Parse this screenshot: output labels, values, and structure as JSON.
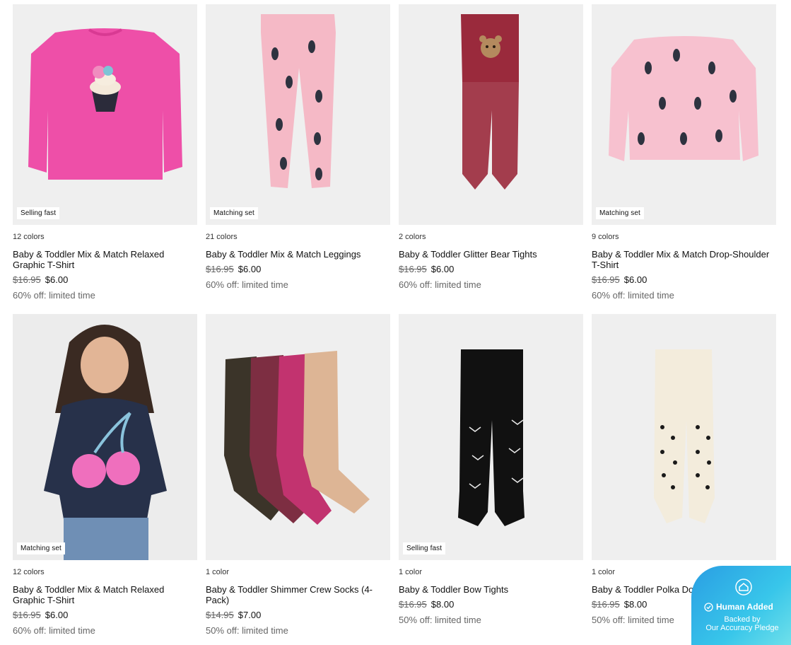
{
  "products": [
    {
      "colors": "12 colors",
      "name": "Baby & Toddler Mix & Match Relaxed Graphic T-Shirt",
      "old_price": "$16.95",
      "price": "$6.00",
      "promo": "60% off: limited time",
      "badge": "Selling fast"
    },
    {
      "colors": "21 colors",
      "name": "Baby & Toddler Mix & Match Leggings",
      "old_price": "$16.95",
      "price": "$6.00",
      "promo": "60% off: limited time",
      "badge": "Matching set"
    },
    {
      "colors": "2 colors",
      "name": "Baby & Toddler Glitter Bear Tights",
      "old_price": "$16.95",
      "price": "$6.00",
      "promo": "60% off: limited time",
      "badge": ""
    },
    {
      "colors": "9 colors",
      "name": "Baby & Toddler Mix & Match Drop-Shoulder T-Shirt",
      "old_price": "$16.95",
      "price": "$6.00",
      "promo": "60% off: limited time",
      "badge": "Matching set"
    },
    {
      "colors": "12 colors",
      "name": "Baby & Toddler Mix & Match Relaxed Graphic T-Shirt",
      "old_price": "$16.95",
      "price": "$6.00",
      "promo": "60% off: limited time",
      "badge": "Matching set"
    },
    {
      "colors": "1 color",
      "name": "Baby & Toddler Shimmer Crew Socks (4-Pack)",
      "old_price": "$14.95",
      "price": "$7.00",
      "promo": "50% off: limited time",
      "badge": ""
    },
    {
      "colors": "1 color",
      "name": "Baby & Toddler Bow Tights",
      "old_price": "$16.95",
      "price": "$8.00",
      "promo": "50% off: limited time",
      "badge": "Selling fast"
    },
    {
      "colors": "1 color",
      "name": "Baby & Toddler Polka Dot Tights",
      "old_price": "$16.95",
      "price": "$8.00",
      "promo": "50% off: limited time",
      "badge": ""
    }
  ],
  "pledge": {
    "title": "Human Added",
    "line1": "Backed by",
    "line2": "Our Accuracy Pledge"
  },
  "icons": {
    "pledge_house": "house-icon",
    "pledge_check": "check-circle-icon"
  }
}
